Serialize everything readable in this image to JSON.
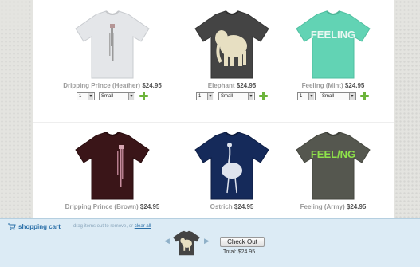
{
  "products": [
    {
      "name": "Dripping Prince (Heather)",
      "price": "$24.95",
      "qty": "1",
      "size": "Small",
      "icon": "tshirt-dripping-prince-heather",
      "color": "#e4e6e9"
    },
    {
      "name": "Elephant",
      "price": "$24.95",
      "qty": "1",
      "size": "Small",
      "icon": "tshirt-elephant",
      "color": "#444444"
    },
    {
      "name": "Feeling (Mint)",
      "price": "$24.95",
      "qty": "1",
      "size": "Small",
      "icon": "tshirt-feeling-mint",
      "color": "#62d3b4",
      "print_text": "FEELING"
    },
    {
      "name": "Dripping Prince (Brown)",
      "price": "$24.95",
      "icon": "tshirt-dripping-prince-brown",
      "color": "#3a1518"
    },
    {
      "name": "Ostrich",
      "price": "$24.95",
      "icon": "tshirt-ostrich",
      "color": "#152a5a"
    },
    {
      "name": "Feeling (Army)",
      "price": "$24.95",
      "icon": "tshirt-feeling-army",
      "color": "#55574f",
      "print_text": "FEEL/NG"
    }
  ],
  "cart": {
    "title": "shopping cart",
    "hint": "drag items out to remove, or",
    "clear_label": "clear all",
    "checkout_label": "Check Out",
    "total": "Total: $24.95",
    "icon": "shopping-cart-icon"
  },
  "colors": {
    "accent": "#2a6fa8",
    "add": "#6cb43a",
    "cart_bg": "#dcebf5"
  }
}
